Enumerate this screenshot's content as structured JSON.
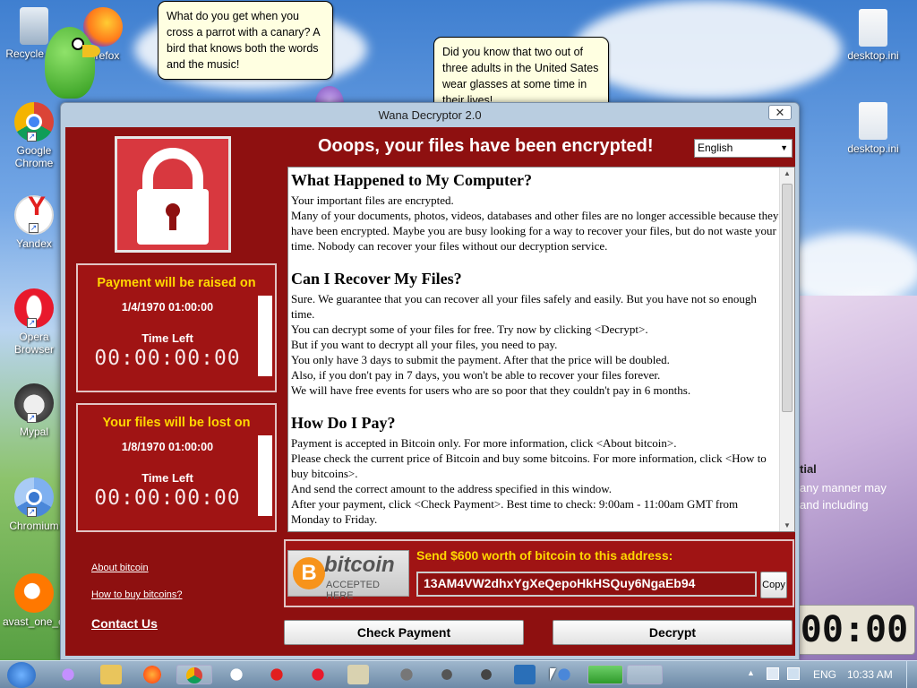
{
  "desktop_icons": [
    {
      "label": "Recycle Bin",
      "icon": "recycle-bin-icon"
    },
    {
      "label": "Firefox",
      "icon": "firefox-icon"
    },
    {
      "label": "Google Chrome",
      "icon": "chrome-icon"
    },
    {
      "label": "Yandex",
      "icon": "yandex-icon"
    },
    {
      "label": "Opera Browser",
      "icon": "opera-icon"
    },
    {
      "label": "Mypal",
      "icon": "mypal-icon"
    },
    {
      "label": "Chromium",
      "icon": "chromium-icon"
    },
    {
      "label": "avast_one_e...",
      "icon": "avast-icon"
    },
    {
      "label": "desktop.ini",
      "icon": "settings-file-icon"
    },
    {
      "label": "desktop.ini",
      "icon": "settings-file-icon"
    }
  ],
  "bubbles": {
    "parrot_joke": "What do you get when you cross a parrot with a canary? A bird that knows both the words and the music!",
    "glasses_fact": "Did you know that two out of three adults in the United Sates wear glasses at some time in their lives!"
  },
  "window": {
    "title": "Wana Decryptor 2.0",
    "close": "✕",
    "headline": "Ooops, your files have been encrypted!",
    "language": "English"
  },
  "payment_raise": {
    "heading": "Payment will be raised on",
    "date": "1/4/1970 01:00:00",
    "time_left_label": "Time Left",
    "timer": "00:00:00:00"
  },
  "files_lost": {
    "heading": "Your files will be lost on",
    "date": "1/8/1970 01:00:00",
    "time_left_label": "Time Left",
    "timer": "00:00:00:00"
  },
  "links": {
    "about_bitcoin": "About bitcoin",
    "how_to_buy": "How to buy bitcoins?",
    "contact_us": "Contact Us"
  },
  "message": {
    "s1_title": "What Happened to My Computer?",
    "s1_p1": "Your important files are encrypted.",
    "s1_p2": "Many of your documents, photos, videos, databases and other files are no longer accessible because they have been encrypted. Maybe you are busy looking for a way to recover your files, but do not waste your time. Nobody can recover your files without our decryption service.",
    "s2_title": "Can I Recover My Files?",
    "s2_p1": "Sure. We guarantee that you can recover all your files safely and easily. But you have not so enough time.",
    "s2_p2": "You can decrypt some of your files for free. Try now by clicking <Decrypt>.",
    "s2_p3": "But if you want to decrypt all your files, you need to pay.",
    "s2_p4": "You only have 3 days to submit the payment. After that the price will be doubled.",
    "s2_p5": "Also, if you don't pay in 7 days, you won't be able to recover your files forever.",
    "s2_p6": "We will have free events for users who are so poor that they couldn't pay in 6 months.",
    "s3_title": "How Do I Pay?",
    "s3_p1": "Payment is accepted in Bitcoin only. For more information, click <About bitcoin>.",
    "s3_p2": "Please check the current price of Bitcoin and buy some bitcoins. For more information, click <How to buy bitcoins>.",
    "s3_p3": "And send the correct amount to the address specified in this window.",
    "s3_p4": "After your payment, click <Check Payment>. Best time to check: 9:00am - 11:00am GMT from Monday to Friday."
  },
  "bitcoin": {
    "logo_word": "bitcoin",
    "logo_sub": "ACCEPTED HERE",
    "send_label": "Send $600 worth of bitcoin to this address:",
    "address": "13AM4VW2dhxYgXeQepoHkHSQuy6NgaEb94",
    "copy": "Copy"
  },
  "buttons": {
    "check_payment": "Check Payment",
    "decrypt": "Decrypt"
  },
  "background_fragments": {
    "tial": "tial",
    "any_manner": "any manner may",
    "and_including": "and including",
    "clock": "00:00"
  },
  "taskbar": {
    "language": "ENG",
    "time": "10:33 AM"
  },
  "colors": {
    "window_red": "#8e1010",
    "panel_red": "#a01414",
    "heading_yellow": "#ffd700"
  }
}
